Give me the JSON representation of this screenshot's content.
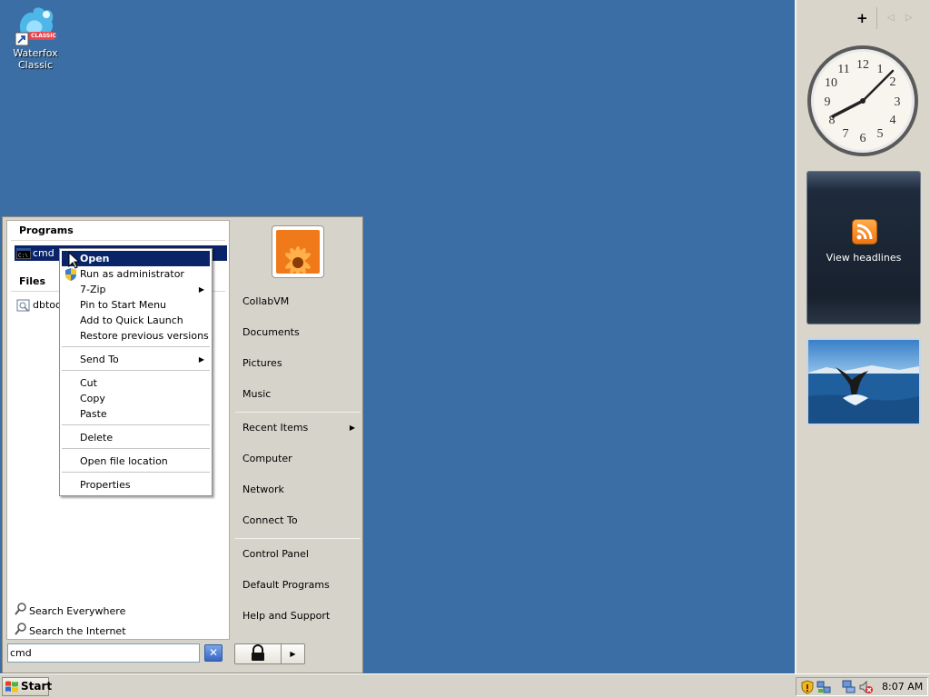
{
  "desktop": {
    "icons": [
      {
        "label_line1": "Waterfox",
        "label_line2": "Classic",
        "badge": "CLASSIC",
        "icon": "waterfox-icon"
      }
    ],
    "background_color": "#3a6ea5"
  },
  "sidebar": {
    "controls": {
      "add": "+",
      "prev": "◁",
      "next": "▷"
    },
    "gadgets": {
      "clock": {
        "icon": "analog-clock",
        "time_hours": 8,
        "time_minutes": 7
      },
      "feed_headlines": {
        "label": "View headlines",
        "icon": "rss-icon"
      },
      "slide_show": {
        "icon": "whale-tail-photo"
      }
    }
  },
  "start_menu": {
    "left": {
      "programs_heading": "Programs",
      "programs": [
        {
          "label": "cmd",
          "icon": "cmd-icon",
          "selected": true
        }
      ],
      "files_heading": "Files",
      "files": [
        {
          "label": "dbtool",
          "icon": "file-icon"
        }
      ],
      "search_links": [
        {
          "label": "Search Everywhere",
          "icon": "search-icon"
        },
        {
          "label": "Search the Internet",
          "icon": "search-icon"
        }
      ],
      "search_value": "cmd"
    },
    "right": {
      "user_picture": "flower-user-picture",
      "items": [
        {
          "label": "CollabVM"
        },
        {
          "label": "Documents"
        },
        {
          "label": "Pictures"
        },
        {
          "label": "Music"
        },
        {
          "label": "Recent Items",
          "submenu": true
        },
        {
          "label": "Computer"
        },
        {
          "label": "Network"
        },
        {
          "label": "Connect To"
        },
        {
          "label": "Control Panel"
        },
        {
          "label": "Default Programs"
        },
        {
          "label": "Help and Support"
        }
      ]
    },
    "power": {
      "lock_icon": "lock-icon",
      "arrow": "▶"
    }
  },
  "context_menu": {
    "items": [
      {
        "label": "Open",
        "highlighted": true
      },
      {
        "label": "Run as administrator",
        "icon": "uac-shield-icon"
      },
      {
        "label": "7-Zip",
        "submenu": true
      },
      {
        "label": "Pin to Start Menu"
      },
      {
        "label": "Add to Quick Launch"
      },
      {
        "label": "Restore previous versions"
      },
      {
        "label": "Send To",
        "submenu": true
      },
      {
        "label": "Cut"
      },
      {
        "label": "Copy"
      },
      {
        "label": "Paste"
      },
      {
        "label": "Delete"
      },
      {
        "label": "Open file location"
      },
      {
        "label": "Properties"
      }
    ]
  },
  "taskbar": {
    "start_label": "Start",
    "tray_icons": [
      "security-shield-icon",
      "network-status-icon",
      "network-disconnected-icon",
      "volume-muted-icon"
    ],
    "clock": "8:07 AM"
  }
}
